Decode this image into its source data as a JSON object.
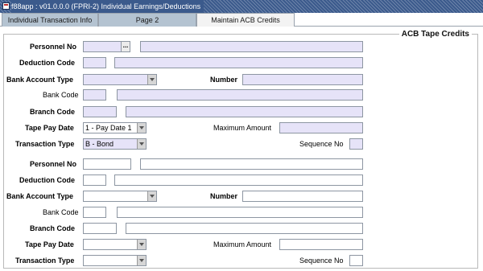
{
  "window": {
    "title": "f88app : v01.0.0.0 (FPRI-2) Individual Earnings/Deductions"
  },
  "tabs": [
    {
      "label": "Individual Transaction Info"
    },
    {
      "label": "Page 2"
    },
    {
      "label": "Maintain ACB Credits"
    }
  ],
  "panel": {
    "title": "ACB Tape Credits"
  },
  "labels": {
    "personnel_no": "Personnel No",
    "deduction_code": "Deduction Code",
    "bank_account_type": "Bank Account Type",
    "number": "Number",
    "bank_code": "Bank Code",
    "branch_code": "Branch Code",
    "tape_pay_date": "Tape Pay Date",
    "maximum_amount": "Maximum Amount",
    "transaction_type": "Transaction Type",
    "sequence_no": "Sequence No"
  },
  "lookup_button": {
    "label": "..."
  },
  "record1": {
    "tape_pay_date": "1 - Pay Date 1",
    "transaction_type": "B - Bond"
  },
  "record2": {
    "tape_pay_date": "",
    "transaction_type": ""
  }
}
